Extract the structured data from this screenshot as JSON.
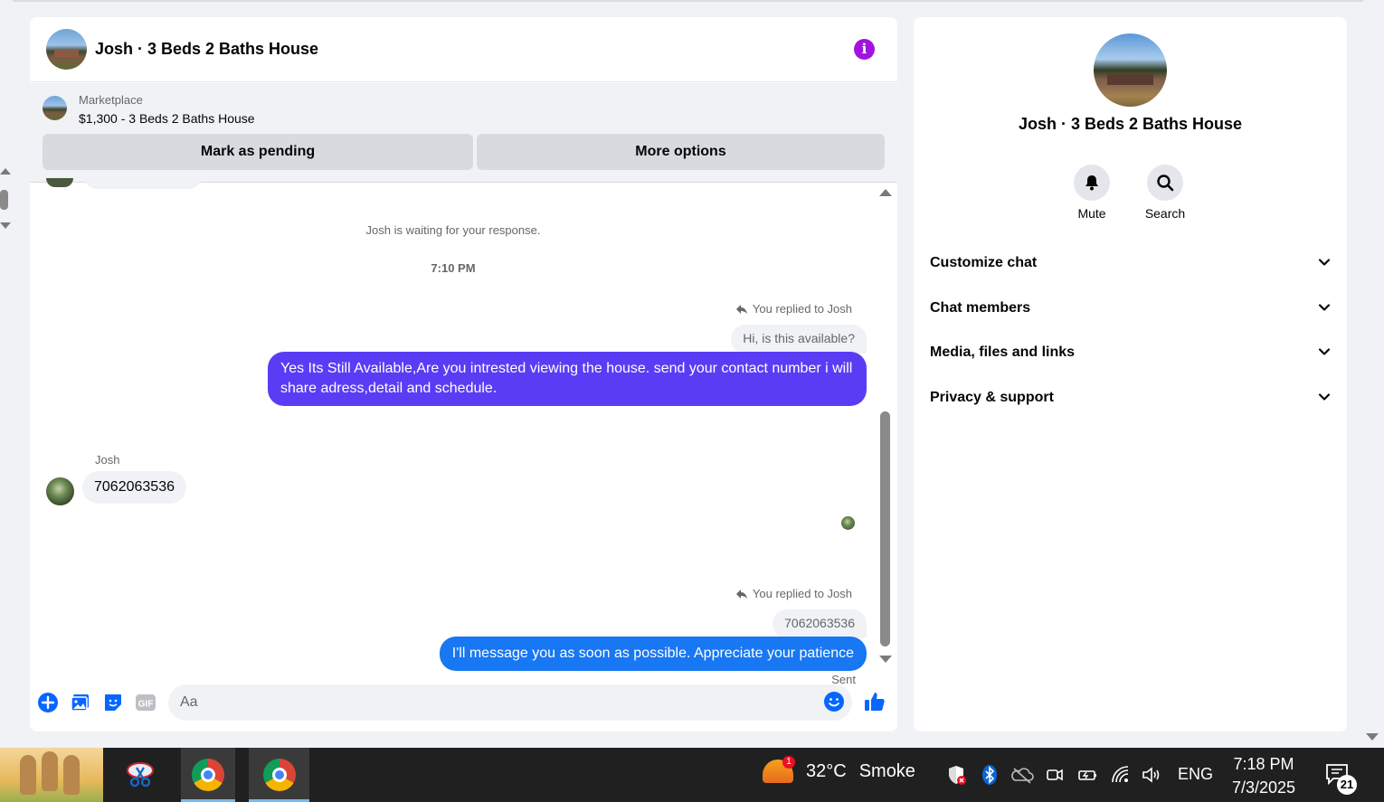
{
  "chat": {
    "title": "Josh · 3 Beds 2 Baths House",
    "marketplace": {
      "label": "Marketplace",
      "listing": "$1,300 - 3 Beds 2 Baths House",
      "mark_pending": "Mark as pending",
      "more_options": "More options"
    },
    "messages": {
      "waiting": "Josh is waiting for your response.",
      "time": "7:10 PM",
      "reply1_label": "You replied to Josh",
      "reply1_quote": "Hi, is this available?",
      "reply1_text": "Yes Its Still Available,Are you intrested viewing the house. send your contact number i will share adress,detail and schedule.",
      "incoming_sender": "Josh",
      "incoming_text": "7062063536",
      "reply2_label": "You replied to Josh",
      "reply2_quote": "7062063536",
      "reply2_text": "I'll message you as soon as possible. Appreciate your patience",
      "status": "Sent"
    },
    "composer": {
      "placeholder": "Aa",
      "icons": [
        "plus-icon",
        "photo-icon",
        "sticker-icon",
        "gif-icon",
        "emoji-icon",
        "like-icon"
      ]
    }
  },
  "info_panel": {
    "title": "Josh · 3 Beds 2 Baths House",
    "mute_label": "Mute",
    "search_label": "Search",
    "sections": [
      "Customize chat",
      "Chat members",
      "Media, files and links",
      "Privacy & support"
    ]
  },
  "taskbar": {
    "weather_temp": "32°C",
    "weather_desc": "Smoke",
    "weather_badge": "1",
    "language": "ENG",
    "time": "7:18 PM",
    "date": "7/3/2025",
    "notifications": "21"
  },
  "colors": {
    "accent_purple": "#a213e0",
    "bubble_purple": "#5b3cf5",
    "bubble_blue": "#1877f2"
  }
}
